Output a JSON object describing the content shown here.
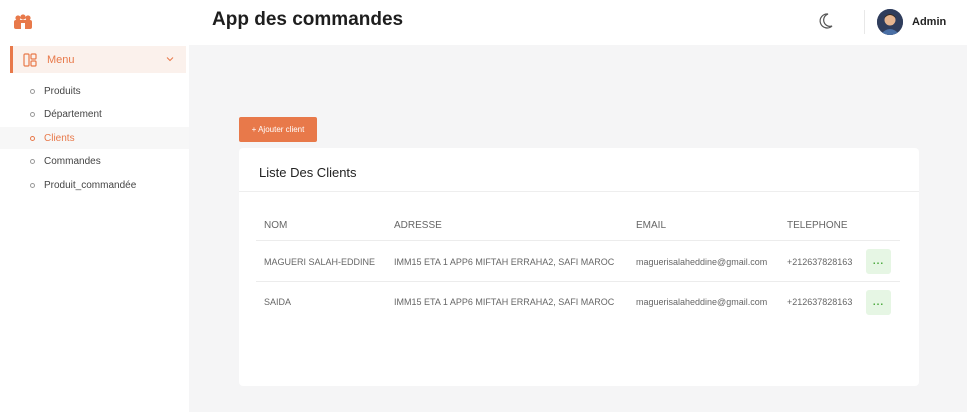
{
  "app": {
    "title": "App des commandes",
    "user_name": "Admin"
  },
  "colors": {
    "accent": "#e8794a",
    "action_bg": "#e6f6e4",
    "action_fg": "#49a83c"
  },
  "sidebar": {
    "menu_label": "Menu",
    "items": [
      {
        "label": "Produits",
        "active": false
      },
      {
        "label": "Département",
        "active": false
      },
      {
        "label": "Clients",
        "active": true
      },
      {
        "label": "Commandes",
        "active": false
      },
      {
        "label": "Produit_commandée",
        "active": false
      }
    ]
  },
  "toolbar": {
    "add_label": "+ Ajouter client"
  },
  "table": {
    "title": "Liste Des Clients",
    "headers": [
      "NOM",
      "ADRESSE",
      "EMAIL",
      "TELEPHONE"
    ],
    "rows": [
      {
        "nom": "MAGUERI SALAH-EDDINE",
        "adresse": "IMM15 ETA 1 APP6 MIFTAH ERRAHA2, SAFI MAROC",
        "email": "maguerisalaheddine@gmail.com",
        "telephone": "+212637828163",
        "action": "..."
      },
      {
        "nom": "SAIDA",
        "adresse": "IMM15 ETA 1 APP6 MIFTAH ERRAHA2, SAFI MAROC",
        "email": "maguerisalaheddine@gmail.com",
        "telephone": "+212637828163",
        "action": "..."
      }
    ]
  },
  "icons": {
    "logo": "app-logo-icon",
    "menu": "grid-icon",
    "chevron": "chevron-down-icon",
    "theme": "moon-icon",
    "avatar": "avatar"
  }
}
